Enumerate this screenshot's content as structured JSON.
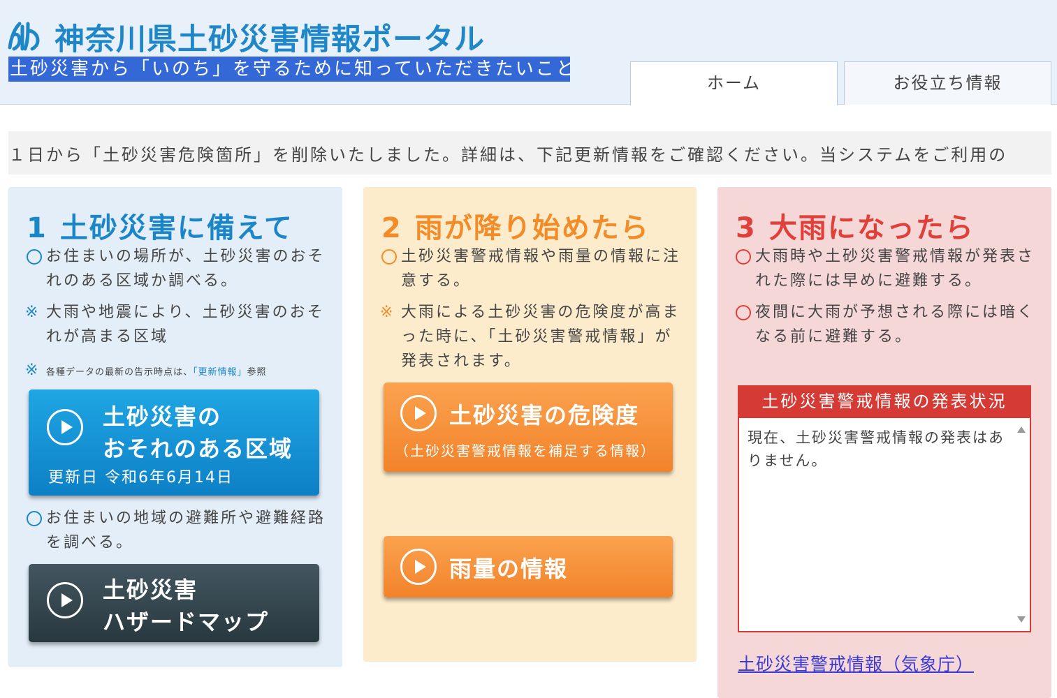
{
  "header": {
    "logo_icon": "kanagawa-emblem-icon",
    "title": "神奈川県土砂災害情報ポータル",
    "subtitle": "土砂災害から「いのち」を守るために知っていただきたいこと",
    "tabs": [
      {
        "label": "ホーム"
      },
      {
        "label": "お役立ち情報"
      }
    ]
  },
  "ticker": {
    "text": "１日から「土砂災害危険箇所」を削除いたしました。詳細は、下記更新情報をご確認ください。当システムをご利用の"
  },
  "columns": [
    {
      "number": "1",
      "title": "土砂災害に備えて",
      "items": [
        {
          "mark": "○",
          "text": "お住まいの場所が、土砂災害のおそれのある区域か調べる。"
        },
        {
          "mark": "※",
          "text": "大雨や地震により、土砂災害のおそれが高まる区域"
        },
        {
          "mark": "※",
          "text_before": "各種データの最新の告示時点は、",
          "link": "「更新情報」",
          "text_after": "参照"
        }
      ],
      "button_primary": {
        "label_line1": "土砂災害の",
        "label_line2": "おそれのある区域",
        "sub": "更新日 令和6年6月14日",
        "icon": "play-icon"
      },
      "item_after": {
        "mark": "○",
        "text": "お住まいの地域の避難所や避難経路を調べる。"
      },
      "button_secondary": {
        "label_line1": "土砂災害",
        "label_line2": "ハザードマップ",
        "icon": "play-icon"
      }
    },
    {
      "number": "2",
      "title": "雨が降り始めたら",
      "items": [
        {
          "mark": "○",
          "text": "土砂災害警戒情報や雨量の情報に注意する。"
        },
        {
          "mark": "※",
          "text": "大雨による土砂災害の危険度が高まった時に、「土砂災害警戒情報」が発表されます。"
        }
      ],
      "button_primary": {
        "label": "土砂災害の危険度",
        "sub": "（土砂災害警戒情報を補足する情報）",
        "icon": "play-icon"
      },
      "button_secondary": {
        "label": "雨量の情報",
        "icon": "play-icon"
      }
    },
    {
      "number": "3",
      "title": "大雨になったら",
      "items": [
        {
          "mark": "○",
          "text": "大雨時や土砂災害警戒情報が発表された際には早めに避難する。"
        },
        {
          "mark": "○",
          "text": "夜間に大雨が予想される際には暗くなる前に避難する。"
        }
      ],
      "alert": {
        "heading": "土砂災害警戒情報の発表状況",
        "body": "現在、土砂災害警戒情報の発表はありません。"
      },
      "link": "土砂災害警戒情報（気象庁）"
    }
  ],
  "colors": {
    "blue": "#1b86c7",
    "orange": "#f28c28",
    "red": "#e0403a",
    "subtitle_bg": "#3368d6"
  }
}
